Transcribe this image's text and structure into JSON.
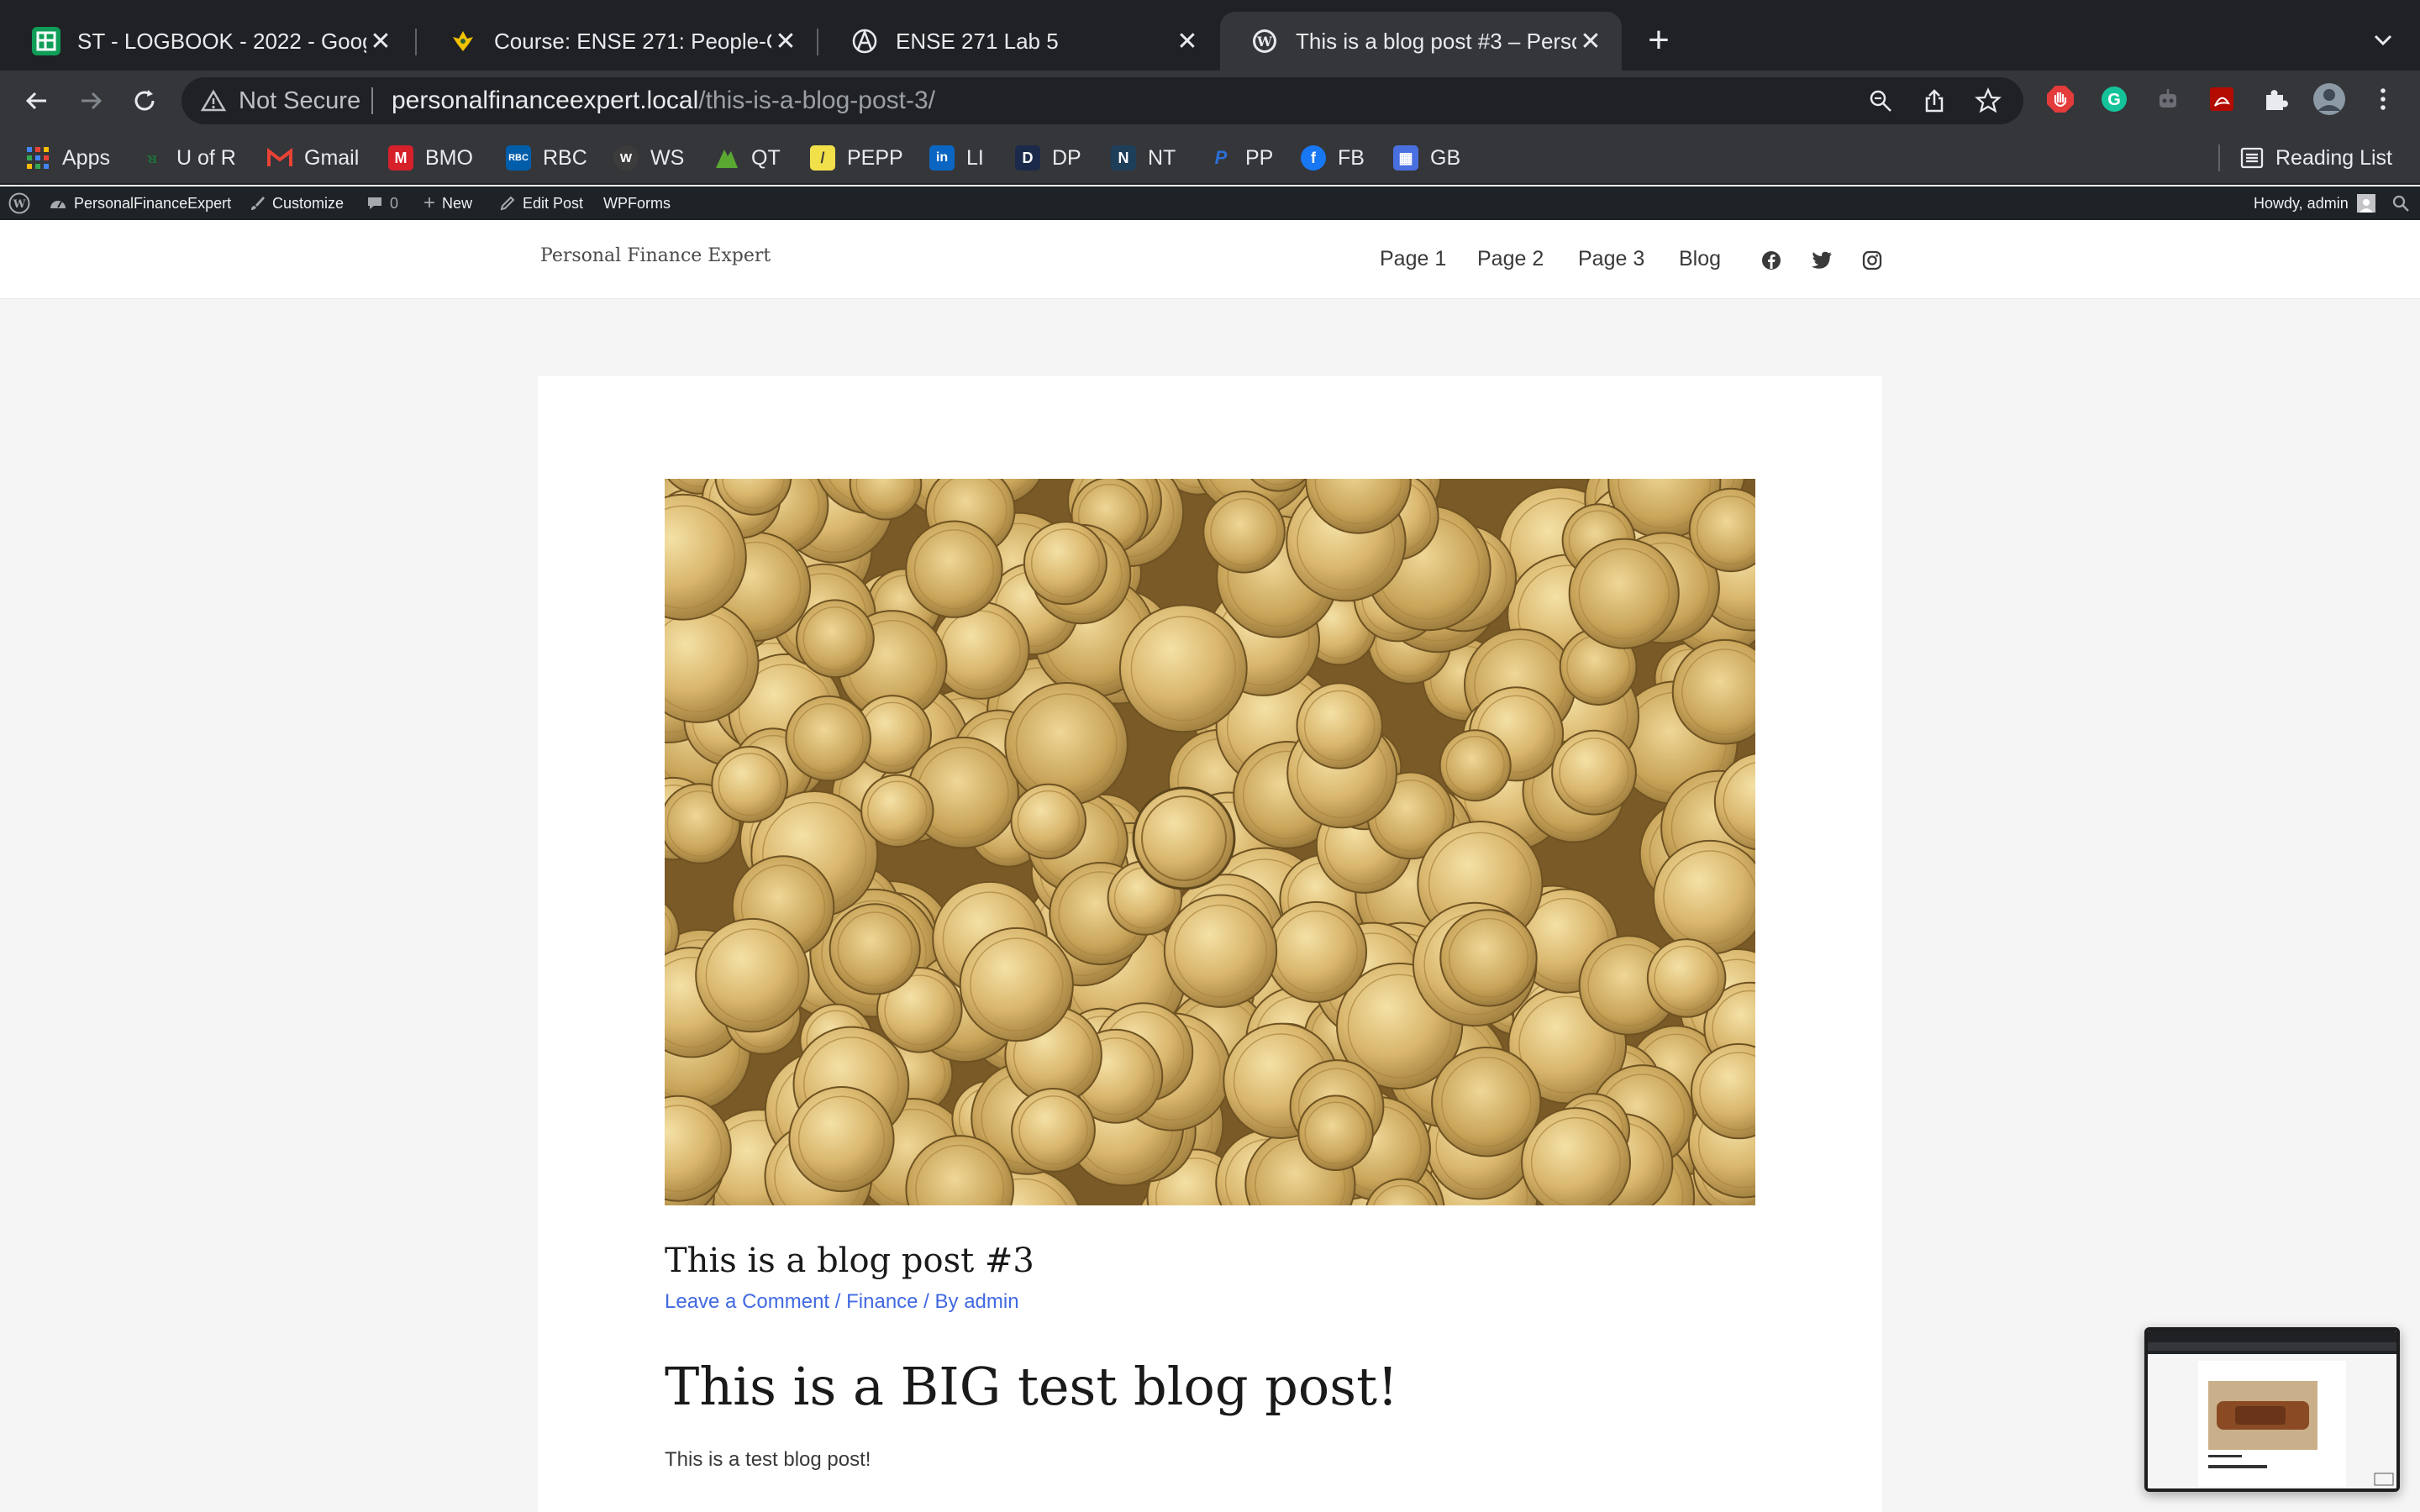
{
  "tabs": [
    {
      "title": "ST - LOGBOOK - 2022 - Googl",
      "icon": "google-sheets-icon",
      "close": "✕"
    },
    {
      "title": "Course: ENSE 271: People-Cen",
      "icon": "uregina-course-icon",
      "close": "✕"
    },
    {
      "title": "ENSE 271 Lab 5",
      "icon": "anarchy-icon",
      "close": "✕"
    },
    {
      "title": "This is a blog post #3 – Person",
      "icon": "wordpress-icon",
      "close": "✕"
    }
  ],
  "new_tab": "+",
  "address": {
    "security": "Not Secure",
    "host": "personalfinanceexpert.local",
    "path": "/this-is-a-blog-post-3/"
  },
  "bookmarks": [
    {
      "label": "Apps",
      "icon": "apps-grid-icon"
    },
    {
      "label": "U of R",
      "icon": "uofr-icon"
    },
    {
      "label": "Gmail",
      "icon": "gmail-icon"
    },
    {
      "label": "BMO",
      "icon": "bmo-icon"
    },
    {
      "label": "RBC",
      "icon": "rbc-icon"
    },
    {
      "label": "WS",
      "icon": "wealthsimple-icon"
    },
    {
      "label": "QT",
      "icon": "questrade-icon"
    },
    {
      "label": "PEPP",
      "icon": "pepp-icon"
    },
    {
      "label": "LI",
      "icon": "linkedin-icon"
    },
    {
      "label": "DP",
      "icon": "dp-icon"
    },
    {
      "label": "NT",
      "icon": "nt-icon"
    },
    {
      "label": "PP",
      "icon": "paypal-icon"
    },
    {
      "label": "FB",
      "icon": "facebook-icon"
    },
    {
      "label": "GB",
      "icon": "gb-icon"
    }
  ],
  "reading_list": "Reading List",
  "adminbar": {
    "site": "PersonalFinanceExpert",
    "customize": "Customize",
    "comments": "0",
    "new": "New",
    "edit": "Edit Post",
    "wpforms": "WPForms",
    "howdy": "Howdy, admin"
  },
  "site": {
    "title": "Personal Finance Expert",
    "nav": [
      "Page 1",
      "Page 2",
      "Page 3",
      "Blog"
    ]
  },
  "post": {
    "title": "This is a blog post #3",
    "meta": {
      "comment": "Leave a Comment",
      "sep1": " / ",
      "category": "Finance",
      "sep2": " / By ",
      "author": "admin"
    },
    "heading": "This is a BIG test blog post!",
    "body": "This is a test blog post!"
  },
  "colors": {
    "chrome_dark": "#202124",
    "chrome_toolbar": "#35363a",
    "wp_adminbar": "#1d2327",
    "link": "#4169e1",
    "page_bg": "#f5f5f5"
  }
}
